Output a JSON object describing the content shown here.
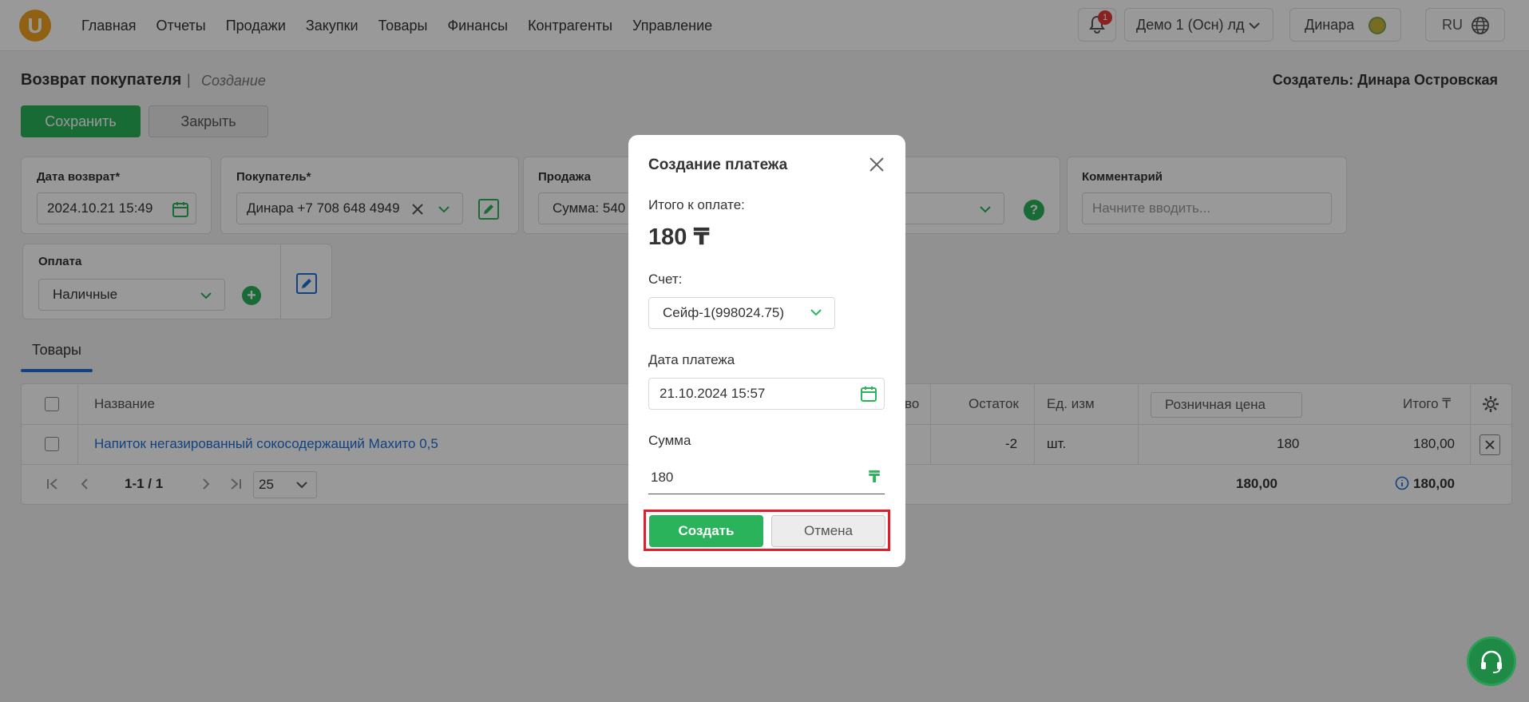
{
  "nav": {
    "logo": "U",
    "items": [
      "Главная",
      "Отчеты",
      "Продажи",
      "Закупки",
      "Товары",
      "Финансы",
      "Контрагенты",
      "Управление"
    ],
    "notifications_count": "1",
    "org": "Демо 1 (Осн) лд",
    "user": "Динара",
    "lang": "RU"
  },
  "page": {
    "title": "Возврат покупателя",
    "separator": "|",
    "subtitle": "Создание",
    "creator": "Создатель: Динара Островская",
    "save_label": "Сохранить",
    "close_label": "Закрыть"
  },
  "form": {
    "return_date_label": "Дата возврат*",
    "return_date_value": "2024.10.21 15:49",
    "buyer_label": "Покупатель*",
    "buyer_value": "Динара +7 708 648 4949",
    "sale_label": "Продажа",
    "sale_value": "Сумма: 540",
    "comment_label": "Комментарий",
    "comment_placeholder": "Начните вводить...",
    "payment_label": "Оплата",
    "payment_value": "Наличные"
  },
  "tabs": {
    "goods": "Товары"
  },
  "table": {
    "headers": {
      "name": "Название",
      "qty_partial": "во",
      "stock": "Остаток",
      "unit": "Ед. изм",
      "price_type": "Розничная цена",
      "total": "Итого ₸"
    },
    "rows": [
      {
        "name": "Напиток негазированный сокосодержащий Махито 0,5",
        "stock": "-2",
        "unit": "шт.",
        "price": "180",
        "total": "180,00"
      }
    ],
    "footer": {
      "pages": "1-1 / 1",
      "per_page": "25",
      "sum_price": "180,00",
      "sum_total": "180,00"
    }
  },
  "modal": {
    "title": "Создание платежа",
    "total_label": "Итого к оплате:",
    "total_value": "180 ₸",
    "account_label": "Счет:",
    "account_value": "Сейф-1(998024.75)",
    "date_label": "Дата платежа",
    "date_value": "21.10.2024 15:57",
    "sum_label": "Сумма",
    "sum_value": "180",
    "currency": "₸",
    "create_label": "Создать",
    "cancel_label": "Отмена"
  },
  "colors": {
    "accent_green": "#2bb35b",
    "link_blue": "#1e6fd9",
    "highlight_red": "#e01e2b"
  }
}
